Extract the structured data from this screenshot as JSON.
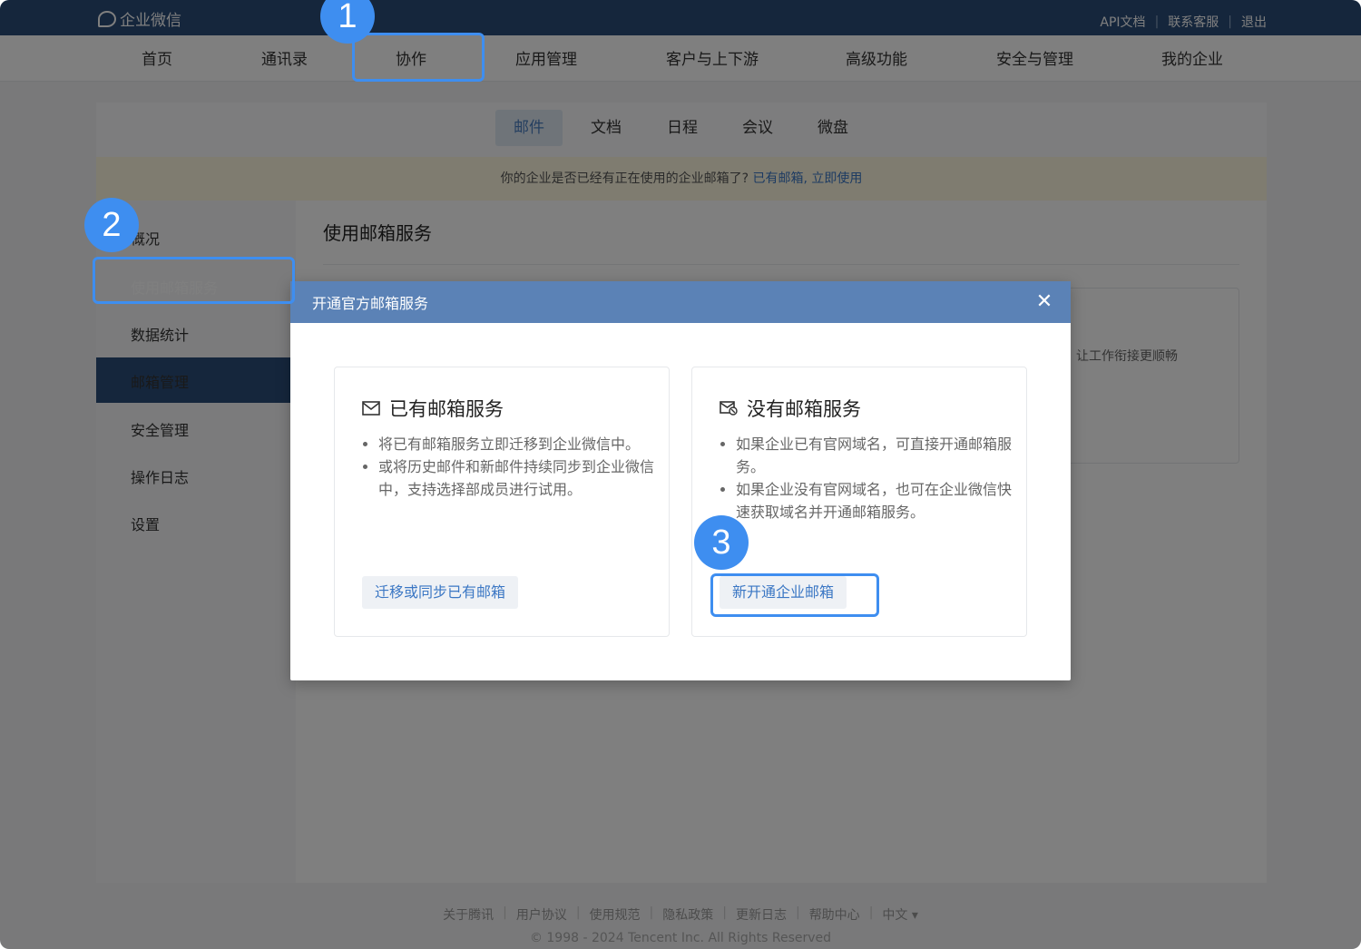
{
  "app": {
    "logo_text": "企业微信"
  },
  "top_links": [
    "API文档",
    "联系客服",
    "退出"
  ],
  "main_nav": [
    "首页",
    "通讯录",
    "协作",
    "应用管理",
    "客户与上下游",
    "高级功能",
    "安全与管理",
    "我的企业"
  ],
  "sub_tabs": [
    "邮件",
    "文档",
    "日程",
    "会议",
    "微盘"
  ],
  "notice": {
    "text": "你的企业是否已经有正在使用的企业邮箱了?",
    "link": "已有邮箱, 立即使用"
  },
  "sidebar": [
    "概况",
    "使用邮箱服务",
    "数据统计",
    "邮箱管理",
    "安全管理",
    "操作日志",
    "设置"
  ],
  "content": {
    "title": "使用邮箱服务",
    "bg_card_text": "让工作衔接更顺畅"
  },
  "modal": {
    "title": "开通官方邮箱服务",
    "close": "✕",
    "left": {
      "title": "已有邮箱服务",
      "bullets": [
        "将已有邮箱服务立即迁移到企业微信中。",
        "或将历史邮件和新邮件持续同步到企业微信中，支持选择部成员进行试用。"
      ],
      "button": "迁移或同步已有邮箱"
    },
    "right": {
      "title": "没有邮箱服务",
      "bullets": [
        "如果企业已有官网域名，可直接开通邮箱服务。",
        "如果企业没有官网域名，也可在企业微信快速获取域名并开通邮箱服务。"
      ],
      "button": "新开通企业邮箱"
    }
  },
  "footer": {
    "links": [
      "关于腾讯",
      "用户协议",
      "使用规范",
      "隐私政策",
      "更新日志",
      "帮助中心",
      "中文 ▾"
    ],
    "copyright": "© 1998 - 2024 Tencent Inc. All Rights Reserved"
  },
  "annotations": [
    "1",
    "2",
    "3"
  ],
  "colors": {
    "topbar": "#2b4d78",
    "modal_header": "#5b82b6",
    "highlight": "#3e8ef0"
  }
}
